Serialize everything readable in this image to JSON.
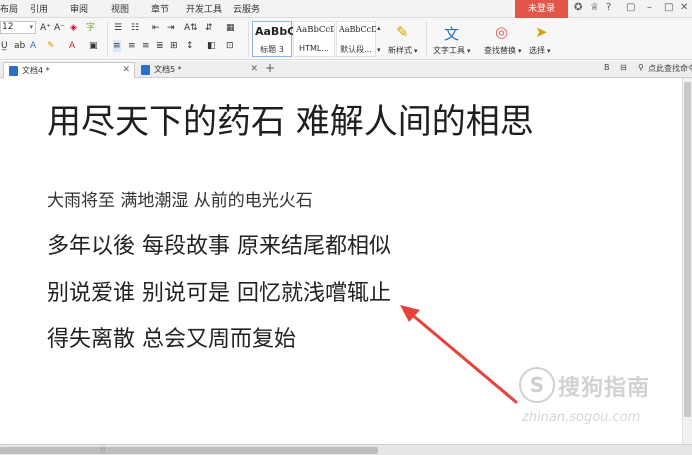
{
  "menubar": {
    "items": [
      "布局",
      "引用",
      "审阅",
      "视图",
      "章节",
      "开发工具",
      "云服务"
    ],
    "login": "未登录"
  },
  "ribbon": {
    "font_size": "12",
    "styles": [
      {
        "sample": "AaBbC",
        "name": "标题 3"
      },
      {
        "sample": "AaBbCcD",
        "name": "HTML..."
      },
      {
        "sample": "AaBbCcDc",
        "name": "默认段..."
      }
    ],
    "new_style": "新样式",
    "text_tools": "文字工具",
    "find_replace": "查找替换",
    "select": "选择"
  },
  "tabs": [
    {
      "label": "文档4 *",
      "active": true
    },
    {
      "label": "文档5 *",
      "active": false
    }
  ],
  "tabstrip": {
    "search": "点此查找命令"
  },
  "document": {
    "title": "用尽天下的药石  难解人间的相思",
    "lines": [
      "大雨将至  满地潮湿  从前的电光火石",
      "多年以後  每段故事  原来结尾都相似",
      "别说爱谁  别说可是  回忆就浅嚐辄止",
      "得失离散  总会又周而复始"
    ]
  },
  "watermark": {
    "brand": "搜狗指南",
    "url": "zhinan.sogou.com"
  },
  "colors": {
    "accent": "#e2564a",
    "arrow": "#e8403a"
  }
}
